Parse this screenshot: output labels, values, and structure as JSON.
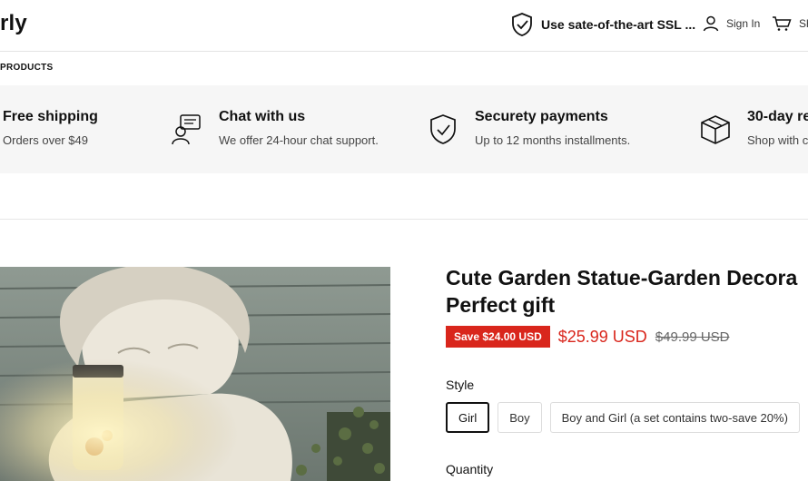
{
  "header": {
    "logo": "rly",
    "ssl_text": "Use sate-of-the-art SSL ...",
    "signin_label": "Sign In",
    "cart_label": "Sh"
  },
  "nav": {
    "products": "PRODUCTS"
  },
  "features": [
    {
      "title": "Free shipping",
      "subtitle": "Orders over $49",
      "icon": "truck-icon"
    },
    {
      "title": "Chat with us",
      "subtitle": "We offer 24-hour chat support.",
      "icon": "chat-support-icon"
    },
    {
      "title": "Securety payments",
      "subtitle": "Up to 12 months installments.",
      "icon": "shield-check-icon"
    },
    {
      "title": "30-day re",
      "subtitle": "Shop with c",
      "icon": "box-icon"
    }
  ],
  "product": {
    "title_line1": "Cute Garden Statue-Garden Decora",
    "title_line2": "Perfect gift",
    "save_badge": "Save $24.00 USD",
    "price": "$25.99 USD",
    "compare_price": "$49.99 USD",
    "style_label": "Style",
    "style_options": [
      "Girl",
      "Boy",
      "Boy and Girl (a set contains two-save 20%)"
    ],
    "selected_style": "Girl",
    "quantity_label": "Quantity",
    "image_alt": "Garden statue of a child holding a firefly jar"
  },
  "colors": {
    "sale_red": "#d9261c",
    "feature_bg": "#f6f6f6"
  }
}
